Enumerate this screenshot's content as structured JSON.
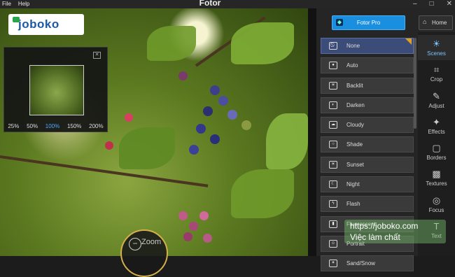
{
  "window": {
    "title": "Fotor",
    "controls": [
      "–",
      "□",
      "✕"
    ]
  },
  "menu": [
    "File",
    "Help"
  ],
  "logo": {
    "text": "joboko"
  },
  "navigator": {
    "close": "✕",
    "zoom_levels": [
      "25%",
      "50%",
      "100%",
      "150%",
      "200%"
    ],
    "active_zoom": "100%"
  },
  "zoom_button": {
    "label": "Zoom"
  },
  "header": {
    "pro_label": "Fotor Pro",
    "home_label": "Home"
  },
  "scenes": [
    {
      "label": "None",
      "icon": "no-symbol-icon",
      "selected": true
    },
    {
      "label": "Auto",
      "icon": "camera-icon"
    },
    {
      "label": "Backlit",
      "icon": "backlight-icon"
    },
    {
      "label": "Darken",
      "icon": "moon-icon"
    },
    {
      "label": "Cloudy",
      "icon": "cloud-icon"
    },
    {
      "label": "Shade",
      "icon": "shade-icon"
    },
    {
      "label": "Sunset",
      "icon": "sunset-icon"
    },
    {
      "label": "Night",
      "icon": "night-icon"
    },
    {
      "label": "Flash",
      "icon": "flash-icon"
    },
    {
      "label": "Fluorescent",
      "icon": "fluorescent-icon"
    },
    {
      "label": "Portrait",
      "icon": "portrait-icon"
    },
    {
      "label": "Sand/Snow",
      "icon": "snow-icon"
    }
  ],
  "tools": [
    {
      "label": "Scenes",
      "icon": "sun-icon",
      "active": true
    },
    {
      "label": "Crop",
      "icon": "crop-icon"
    },
    {
      "label": "Adjust",
      "icon": "pencil-icon"
    },
    {
      "label": "Effects",
      "icon": "sparkle-icon"
    },
    {
      "label": "Borders",
      "icon": "frame-icon"
    },
    {
      "label": "Textures",
      "icon": "checker-icon"
    },
    {
      "label": "Focus",
      "icon": "focus-icon"
    },
    {
      "label": "Text",
      "icon": "text-icon"
    }
  ],
  "watermark": {
    "url": "https://joboko.com",
    "tagline": "Việc làm chất"
  }
}
